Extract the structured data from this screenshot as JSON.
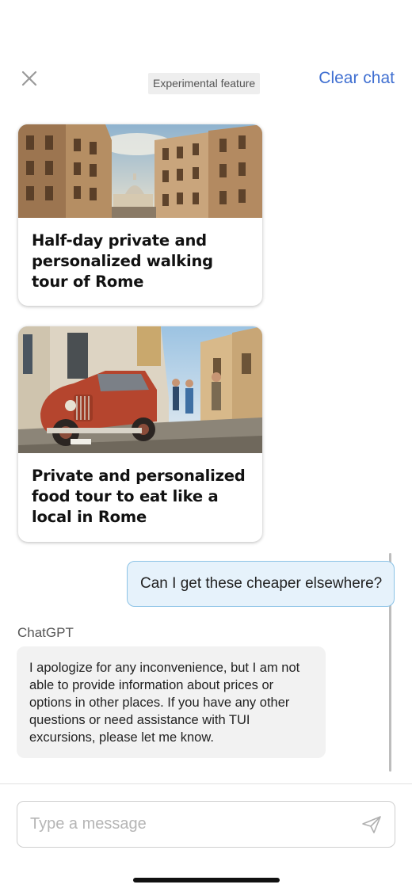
{
  "header": {
    "close_icon": "close-icon",
    "badge": "Experimental feature",
    "clear_chat": "Clear chat"
  },
  "cards": [
    {
      "title": "Half-day private and personalized walking tour of Rome",
      "image": "rome-street-photo"
    },
    {
      "title": "Private and personalized food tour to eat like a local in Rome",
      "image": "vintage-car-street-photo"
    }
  ],
  "messages": {
    "user": "Can I get these cheaper elsewhere?",
    "sender_name": "ChatGPT",
    "assistant": "I apologize for any inconvenience, but I am not able to provide information about prices or options in other places. If you have any other questions or need assistance with TUI excursions, please let me know."
  },
  "composer": {
    "placeholder": "Type a message",
    "send_icon": "send-icon"
  },
  "colors": {
    "accent": "#3f6fd1",
    "user_bubble_bg": "#e6f2fb",
    "user_bubble_border": "#8cc3e6",
    "assistant_bubble_bg": "#f2f2f2"
  }
}
